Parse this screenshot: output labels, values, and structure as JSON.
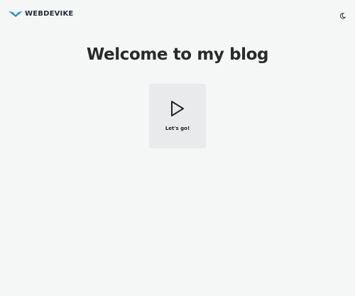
{
  "header": {
    "logo_text": "WEBDEVIKE",
    "logo_icon": "chevron-bird-logo-icon",
    "theme_toggle_icon": "moon-icon"
  },
  "main": {
    "title": "Welcome to my blog",
    "cta": {
      "label": "Let's go!",
      "icon": "play-icon"
    }
  },
  "colors": {
    "background": "#f5f7f7",
    "logo_accent": "#2f95d6",
    "card_background": "#e8eaeb",
    "text": "#2a2a2a"
  }
}
